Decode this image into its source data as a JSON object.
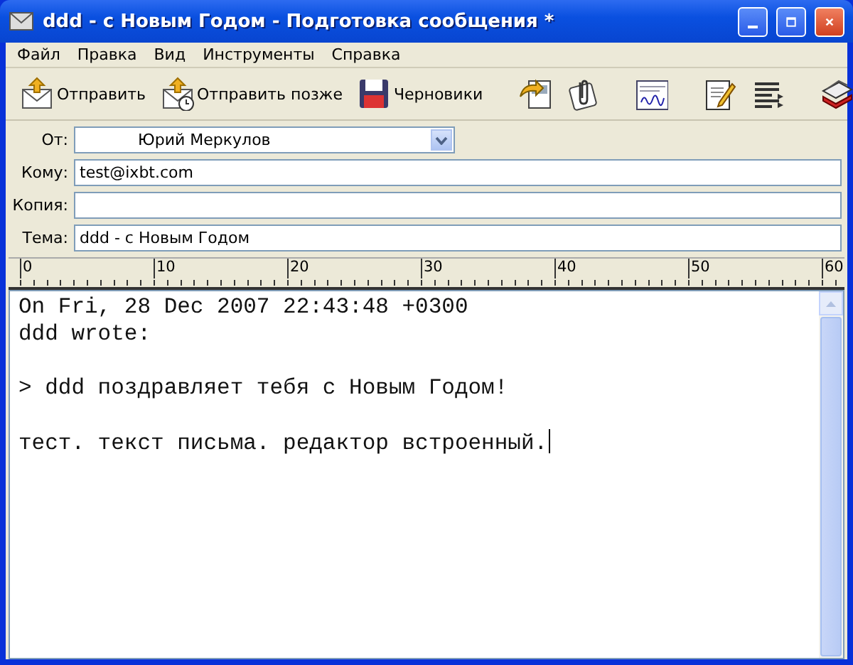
{
  "window": {
    "title": "ddd - с Новым Годом - Подготовка сообщения *"
  },
  "menu": [
    "Файл",
    "Правка",
    "Вид",
    "Инструменты",
    "Справка"
  ],
  "toolbar": [
    {
      "kind": "send",
      "label": "Отправить"
    },
    {
      "kind": "send-later",
      "label": "Отправить позже"
    },
    {
      "kind": "drafts",
      "label": "Черновики"
    },
    {
      "kind": "separator"
    },
    {
      "kind": "page-arrow"
    },
    {
      "kind": "paperclip"
    },
    {
      "kind": "separator"
    },
    {
      "kind": "signature"
    },
    {
      "kind": "separator"
    },
    {
      "kind": "notepad"
    },
    {
      "kind": "lines"
    },
    {
      "kind": "separator"
    },
    {
      "kind": "stack"
    }
  ],
  "header": [
    {
      "kind": "dropdown",
      "label": "От:",
      "value": "Юрий Меркулов"
    },
    {
      "kind": "text",
      "label": "Кому:",
      "value": "test@ixbt.com"
    },
    {
      "kind": "text",
      "label": "Копия:"
    },
    {
      "kind": "text",
      "label": "Тема:",
      "value": "ddd - с Новым Годом"
    }
  ],
  "ruler": [
    "0",
    "10",
    "20",
    "30",
    "40",
    "50",
    "60"
  ],
  "body": [
    [
      "On Fri, 28 Dec 2007 22:43:48 +0300",
      "ddd wrote:"
    ],
    [
      "> ddd поздравляет тебя с Новым Годом!"
    ],
    [
      "тест. текст письма. редактор встроенный."
    ]
  ]
}
